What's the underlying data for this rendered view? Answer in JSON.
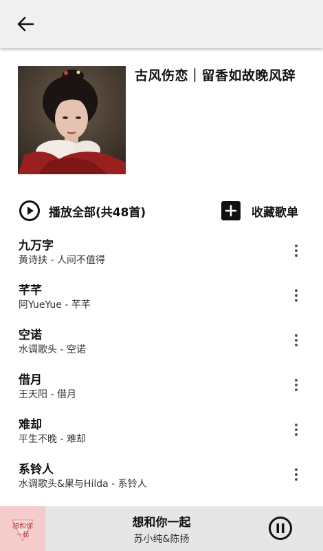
{
  "header": {
    "back_icon": "arrow-left-icon"
  },
  "playlist": {
    "title": "古风伤恋｜留香如故晚风辞",
    "cover_icon": "playlist-cover-image"
  },
  "actions": {
    "play_all_label": "播放全部(共48首)",
    "play_all_icon": "play-circle-icon",
    "collect_label": "收藏歌单",
    "collect_icon": "plus-square-icon"
  },
  "songs": [
    {
      "title": "九万字",
      "subtitle": "黄诗扶 - 人间不值得"
    },
    {
      "title": "芊芊",
      "subtitle": "阿YueYue - 芊芊"
    },
    {
      "title": "空诺",
      "subtitle": "水调歌头 - 空诺"
    },
    {
      "title": "借月",
      "subtitle": "王天阳 - 借月"
    },
    {
      "title": "难却",
      "subtitle": "平生不晚 - 难却"
    },
    {
      "title": "系铃人",
      "subtitle": "水调歌头&果与Hilda - 系铃人"
    }
  ],
  "now_playing": {
    "title": "想和你一起",
    "artist": "苏小纯&陈扬",
    "cover_text": "想和你一起",
    "control_icon": "pause-circle-icon"
  },
  "colors": {
    "topbar_bg": "#f0f0f0",
    "player_bg": "#e6e6e6",
    "text_primary": "#111111",
    "text_secondary": "#333333"
  }
}
